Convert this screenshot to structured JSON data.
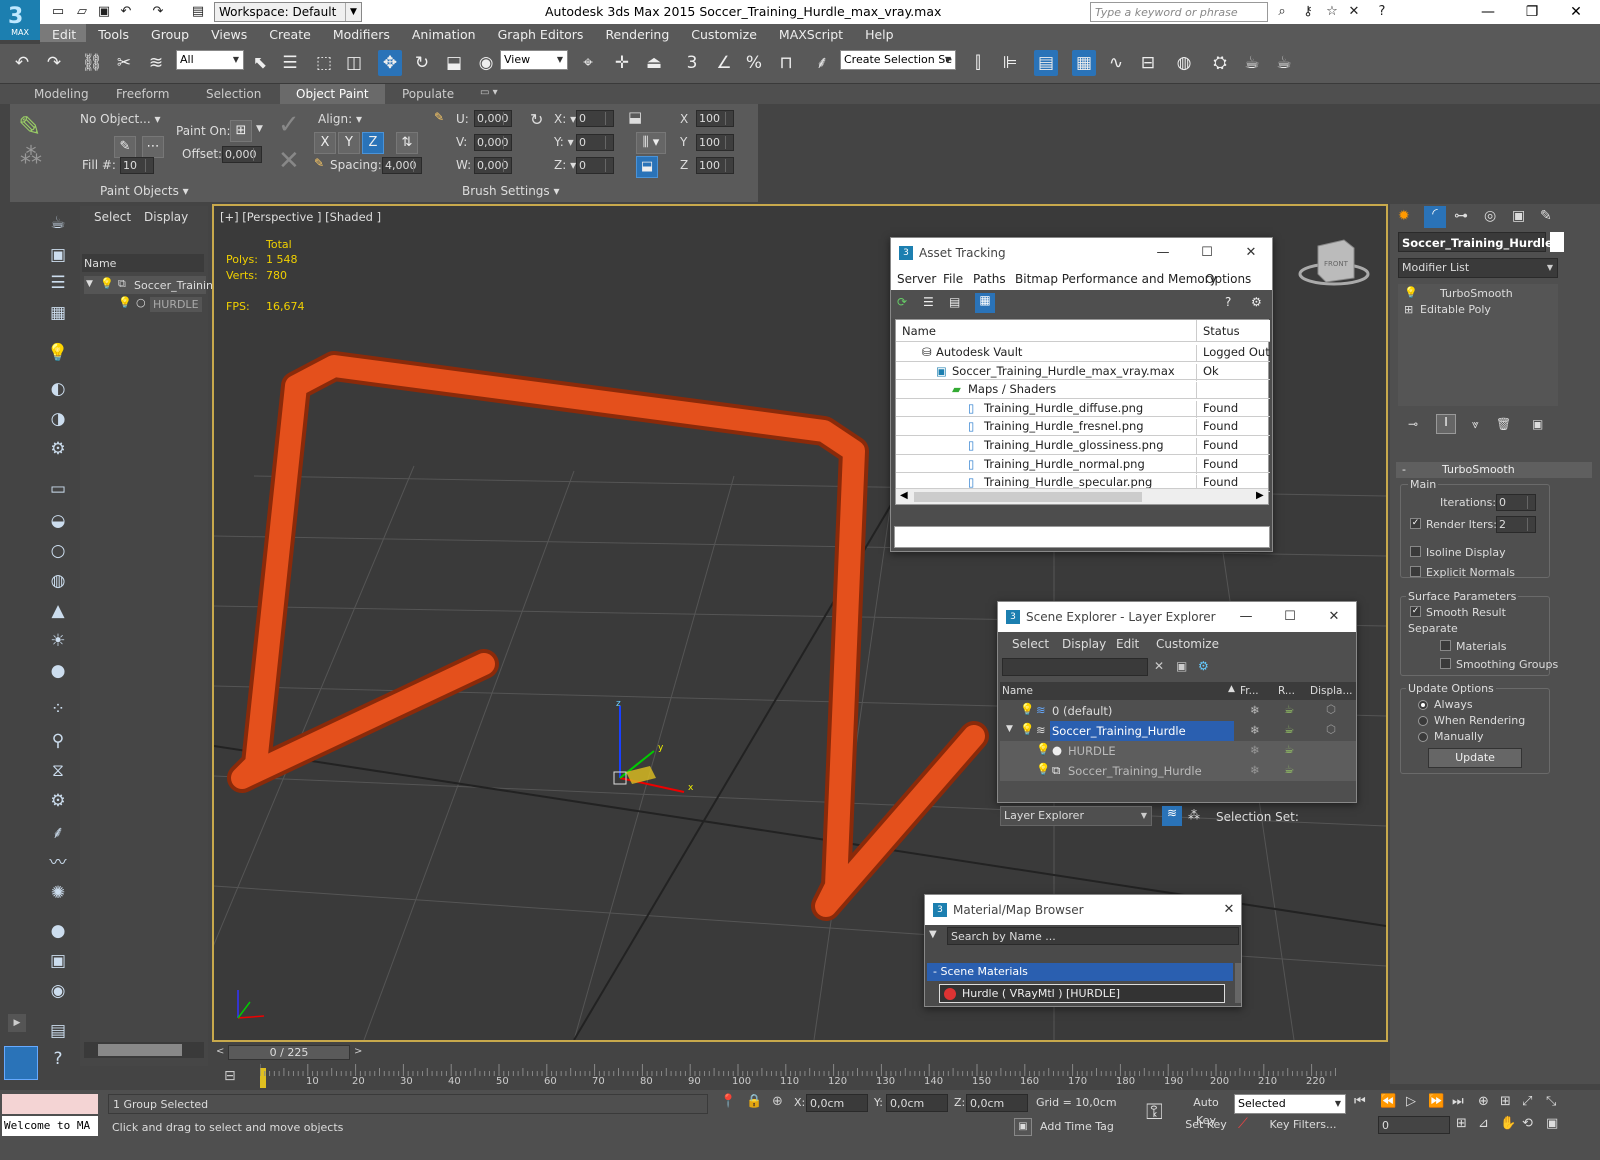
{
  "app": {
    "title": "Autodesk 3ds Max  2015    Soccer_Training_Hurdle_max_vray.max",
    "logo": "MAX",
    "workspace": "Workspace: Default",
    "keyword_placeholder": "Type a keyword or phrase"
  },
  "menu": [
    "Edit",
    "Tools",
    "Group",
    "Views",
    "Create",
    "Modifiers",
    "Animation",
    "Graph Editors",
    "Rendering",
    "Customize",
    "MAXScript",
    "Help"
  ],
  "toolbar": {
    "filter": "All",
    "view": "View",
    "selset": "Create Selection Se"
  },
  "ribbon": {
    "tabs": [
      "Modeling",
      "Freeform",
      "Selection",
      "Object Paint",
      "Populate"
    ],
    "no_object": "No Object...",
    "paint_on": "Paint On:",
    "offset_label": "Offset:",
    "offset_val": "0,000",
    "fill_label": "Fill #:",
    "fill_val": "10",
    "group1": "Paint Objects",
    "align": "Align:",
    "spacing": "Spacing:",
    "spacing_val": "4,000",
    "u": "U:",
    "v": "V:",
    "w": "W:",
    "uv": "0,000",
    "x": "X",
    "y": "Y",
    "z": "Z",
    "rot_val": "0",
    "scale_val": "100",
    "group2": "Brush Settings"
  },
  "scene": {
    "tabs": [
      "Select",
      "Display"
    ],
    "name_header": "Name",
    "root": "Soccer_Trainin",
    "child": "HURDLE"
  },
  "viewport": {
    "label": "[+] [Perspective ] [Shaded ]",
    "total": "Total",
    "polys_l": "Polys:",
    "polys": "1 548",
    "verts_l": "Verts:",
    "verts": "780",
    "fps_l": "FPS:",
    "fps": "16,674",
    "cube": "FRONT"
  },
  "asset": {
    "title": "Asset Tracking",
    "menu": [
      "Server",
      "File",
      "Paths",
      "Bitmap Performance and Memory",
      "Options"
    ],
    "cols": [
      "Name",
      "Status"
    ],
    "rows": [
      {
        "name": "Autodesk Vault",
        "status": "Logged Out ."
      },
      {
        "name": "Soccer_Training_Hurdle_max_vray.max",
        "status": "Ok"
      },
      {
        "name": "Maps / Shaders",
        "status": ""
      },
      {
        "name": "Training_Hurdle_diffuse.png",
        "status": "Found"
      },
      {
        "name": "Training_Hurdle_fresnel.png",
        "status": "Found"
      },
      {
        "name": "Training_Hurdle_glossiness.png",
        "status": "Found"
      },
      {
        "name": "Training_Hurdle_normal.png",
        "status": "Found"
      },
      {
        "name": "Training_Hurdle_specular.png",
        "status": "Found"
      }
    ]
  },
  "layer": {
    "title": "Scene Explorer - Layer Explorer",
    "menu": [
      "Select",
      "Display",
      "Edit",
      "Customize"
    ],
    "cols": [
      "Name",
      "Fr...",
      "R...",
      "Displa..."
    ],
    "rows": [
      "0 (default)",
      "Soccer_Training_Hurdle",
      "HURDLE",
      "Soccer_Training_Hurdle"
    ],
    "footer_combo": "Layer Explorer",
    "selset": "Selection Set:"
  },
  "matbrowser": {
    "title": "Material/Map Browser",
    "search": "Search by Name ...",
    "section": "- Scene Materials",
    "item": "Hurdle  ( VRayMtl )  [HURDLE]"
  },
  "cmd": {
    "obj_name": "Soccer_Training_Hurdle",
    "modlist": "Modifier List",
    "stack": [
      "TurboSmooth",
      "Editable Poly"
    ],
    "rollout": "TurboSmooth",
    "main": "Main",
    "iter_l": "Iterations:",
    "iter": "0",
    "render_iters": "Render Iters:",
    "render_val": "2",
    "isoline": "Isoline Display",
    "explicit": "Explicit Normals",
    "surface": "Surface Parameters",
    "smooth": "Smooth Result",
    "separate": "Separate",
    "materials": "Materials",
    "smoothing": "Smoothing Groups",
    "update_opts": "Update Options",
    "always": "Always",
    "when": "When Rendering",
    "manually": "Manually",
    "update_btn": "Update"
  },
  "timeline": {
    "frame": "0 / 225",
    "ticks": [
      "10",
      "20",
      "30",
      "40",
      "50",
      "60",
      "70",
      "80",
      "90",
      "100",
      "110",
      "120",
      "130",
      "140",
      "150",
      "160",
      "170",
      "180",
      "190",
      "200",
      "210",
      "220"
    ]
  },
  "status": {
    "listener": "Welcome to MA",
    "selected": "1 Group Selected",
    "hint": "Click and drag to select and move objects",
    "x": "0,0cm",
    "y": "0,0cm",
    "z": "0,0cm",
    "x_l": "X:",
    "y_l": "Y:",
    "z_l": "Z:",
    "grid": "Grid = 10,0cm",
    "autokey": "Auto Key",
    "setkey": "Set Key",
    "selected_combo": "Selected",
    "keyfilters": "Key Filters...",
    "addtime": "Add Time Tag",
    "frame": "0"
  },
  "colors": {
    "accent": "#2a73b8",
    "hurdle": "#e4501c",
    "viewport_border": "#c8a94c"
  }
}
